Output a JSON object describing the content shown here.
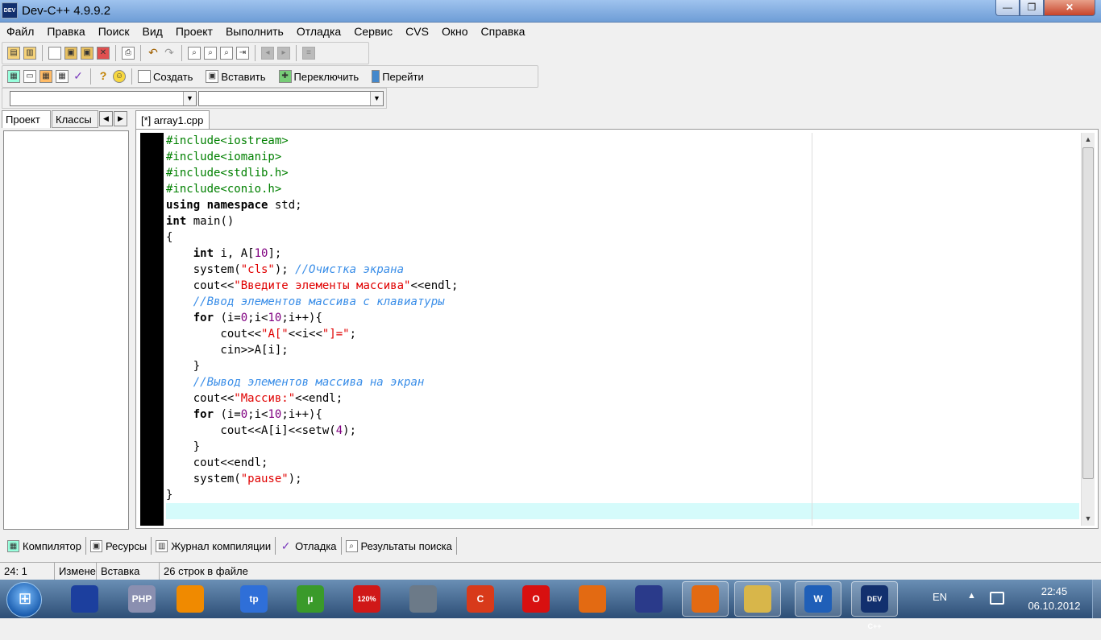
{
  "window": {
    "title": "Dev-C++ 4.9.9.2",
    "icon": "DEV"
  },
  "titlebar_buttons": {
    "minimize": "—",
    "maximize": "❐",
    "close": "✕"
  },
  "menu": [
    "Файл",
    "Правка",
    "Поиск",
    "Вид",
    "Проект",
    "Выполнить",
    "Отладка",
    "Сервис",
    "CVS",
    "Окно",
    "Справка"
  ],
  "toolbar2": {
    "create": "Создать",
    "insert": "Вставить",
    "switch": "Переключить",
    "goto": "Перейти"
  },
  "left_tabs": {
    "project": "Проект",
    "classes": "Классы"
  },
  "editor_tab": "[*] array1.cpp",
  "code": [
    [
      [
        "pp",
        "#include<iostream>"
      ]
    ],
    [
      [
        "pp",
        "#include<iomanip>"
      ]
    ],
    [
      [
        "pp",
        "#include<stdlib.h>"
      ]
    ],
    [
      [
        "pp",
        "#include<conio.h>"
      ]
    ],
    [
      [
        "kw",
        "using"
      ],
      [
        "sym",
        " "
      ],
      [
        "kw",
        "namespace"
      ],
      [
        "sym",
        " std;"
      ]
    ],
    [
      [
        "kw",
        "int"
      ],
      [
        "sym",
        " main()"
      ]
    ],
    [
      [
        "sym",
        "{"
      ]
    ],
    [
      [
        "sym",
        "    "
      ],
      [
        "kw",
        "int"
      ],
      [
        "sym",
        " i, A["
      ],
      [
        "num",
        "10"
      ],
      [
        "sym",
        "];"
      ]
    ],
    [
      [
        "sym",
        "    system("
      ],
      [
        "str",
        "\"cls\""
      ],
      [
        "sym",
        "); "
      ],
      [
        "cm",
        "//Очистка экрана"
      ]
    ],
    [
      [
        "sym",
        "    cout<<"
      ],
      [
        "str",
        "\"Введите элементы массива\""
      ],
      [
        "sym",
        "<<endl;"
      ]
    ],
    [
      [
        "sym",
        "    "
      ],
      [
        "cm",
        "//Ввод элементов массива с клавиатуры"
      ]
    ],
    [
      [
        "sym",
        "    "
      ],
      [
        "kw",
        "for"
      ],
      [
        "sym",
        " (i="
      ],
      [
        "num",
        "0"
      ],
      [
        "sym",
        ";i<"
      ],
      [
        "num",
        "10"
      ],
      [
        "sym",
        ";i++){"
      ]
    ],
    [
      [
        "sym",
        "        cout<<"
      ],
      [
        "str",
        "\"A[\""
      ],
      [
        "sym",
        "<<i<<"
      ],
      [
        "str",
        "\"]=\""
      ],
      [
        "sym",
        ";"
      ]
    ],
    [
      [
        "sym",
        "        cin>>A[i];"
      ]
    ],
    [
      [
        "sym",
        "    }"
      ]
    ],
    [
      [
        "sym",
        "    "
      ],
      [
        "cm",
        "//Вывод элементов массива на экран"
      ]
    ],
    [
      [
        "sym",
        "    cout<<"
      ],
      [
        "str",
        "\"Массив:\""
      ],
      [
        "sym",
        "<<endl;"
      ]
    ],
    [
      [
        "sym",
        "    "
      ],
      [
        "kw",
        "for"
      ],
      [
        "sym",
        " (i="
      ],
      [
        "num",
        "0"
      ],
      [
        "sym",
        ";i<"
      ],
      [
        "num",
        "10"
      ],
      [
        "sym",
        ";i++){"
      ]
    ],
    [
      [
        "sym",
        "        cout<<A[i]<<setw("
      ],
      [
        "num",
        "4"
      ],
      [
        "sym",
        ");"
      ]
    ],
    [
      [
        "sym",
        "    }"
      ]
    ],
    [
      [
        "sym",
        "    cout<<endl;"
      ]
    ],
    [
      [
        "sym",
        "    system("
      ],
      [
        "str",
        "\"pause\""
      ],
      [
        "sym",
        ");"
      ]
    ],
    [
      [
        "sym",
        "}"
      ]
    ],
    [
      [
        "sym",
        ""
      ]
    ]
  ],
  "bottom_tabs": [
    "Компилятор",
    "Ресурсы",
    "Журнал компиляции",
    "Отладка",
    "Результаты поиска"
  ],
  "status": {
    "position": "24: 1",
    "modified": "Изменен",
    "mode": "Вставка",
    "lines": "26 строк в файле"
  },
  "taskbar": {
    "apps": [
      {
        "name": "library-icon",
        "label": "",
        "color": "#1c3f9e"
      },
      {
        "name": "php-editor-icon",
        "label": "PHP",
        "color": "#8a8fb0"
      },
      {
        "name": "avast-icon",
        "label": "",
        "color": "#f08a00"
      },
      {
        "name": "typing-tutor-icon",
        "label": "tp",
        "color": "#2f6fd8"
      },
      {
        "name": "utorrent-icon",
        "label": "µ",
        "color": "#3a9a2a"
      },
      {
        "name": "acrobat-icon",
        "label": "120%",
        "color": "#d01818"
      },
      {
        "name": "satellite-icon",
        "label": "",
        "color": "#6c7a88"
      },
      {
        "name": "ccleaner-icon",
        "label": "C",
        "color": "#d83a1a"
      },
      {
        "name": "opera-icon",
        "label": "O",
        "color": "#d81010"
      },
      {
        "name": "firefox-icon",
        "label": "",
        "color": "#e36a12"
      },
      {
        "name": "save-disk-icon",
        "label": "",
        "color": "#2a3a8a"
      },
      {
        "name": "firefox-running-icon",
        "label": "",
        "color": "#e36a12"
      },
      {
        "name": "folder-icon",
        "label": "",
        "color": "#d8b64a"
      },
      {
        "name": "word-icon",
        "label": "W",
        "color": "#1f5fb8"
      },
      {
        "name": "devcpp-icon",
        "label": "DEV C++",
        "color": "#12306e"
      }
    ],
    "lang": "EN",
    "time": "22:45",
    "date": "06.10.2012"
  }
}
